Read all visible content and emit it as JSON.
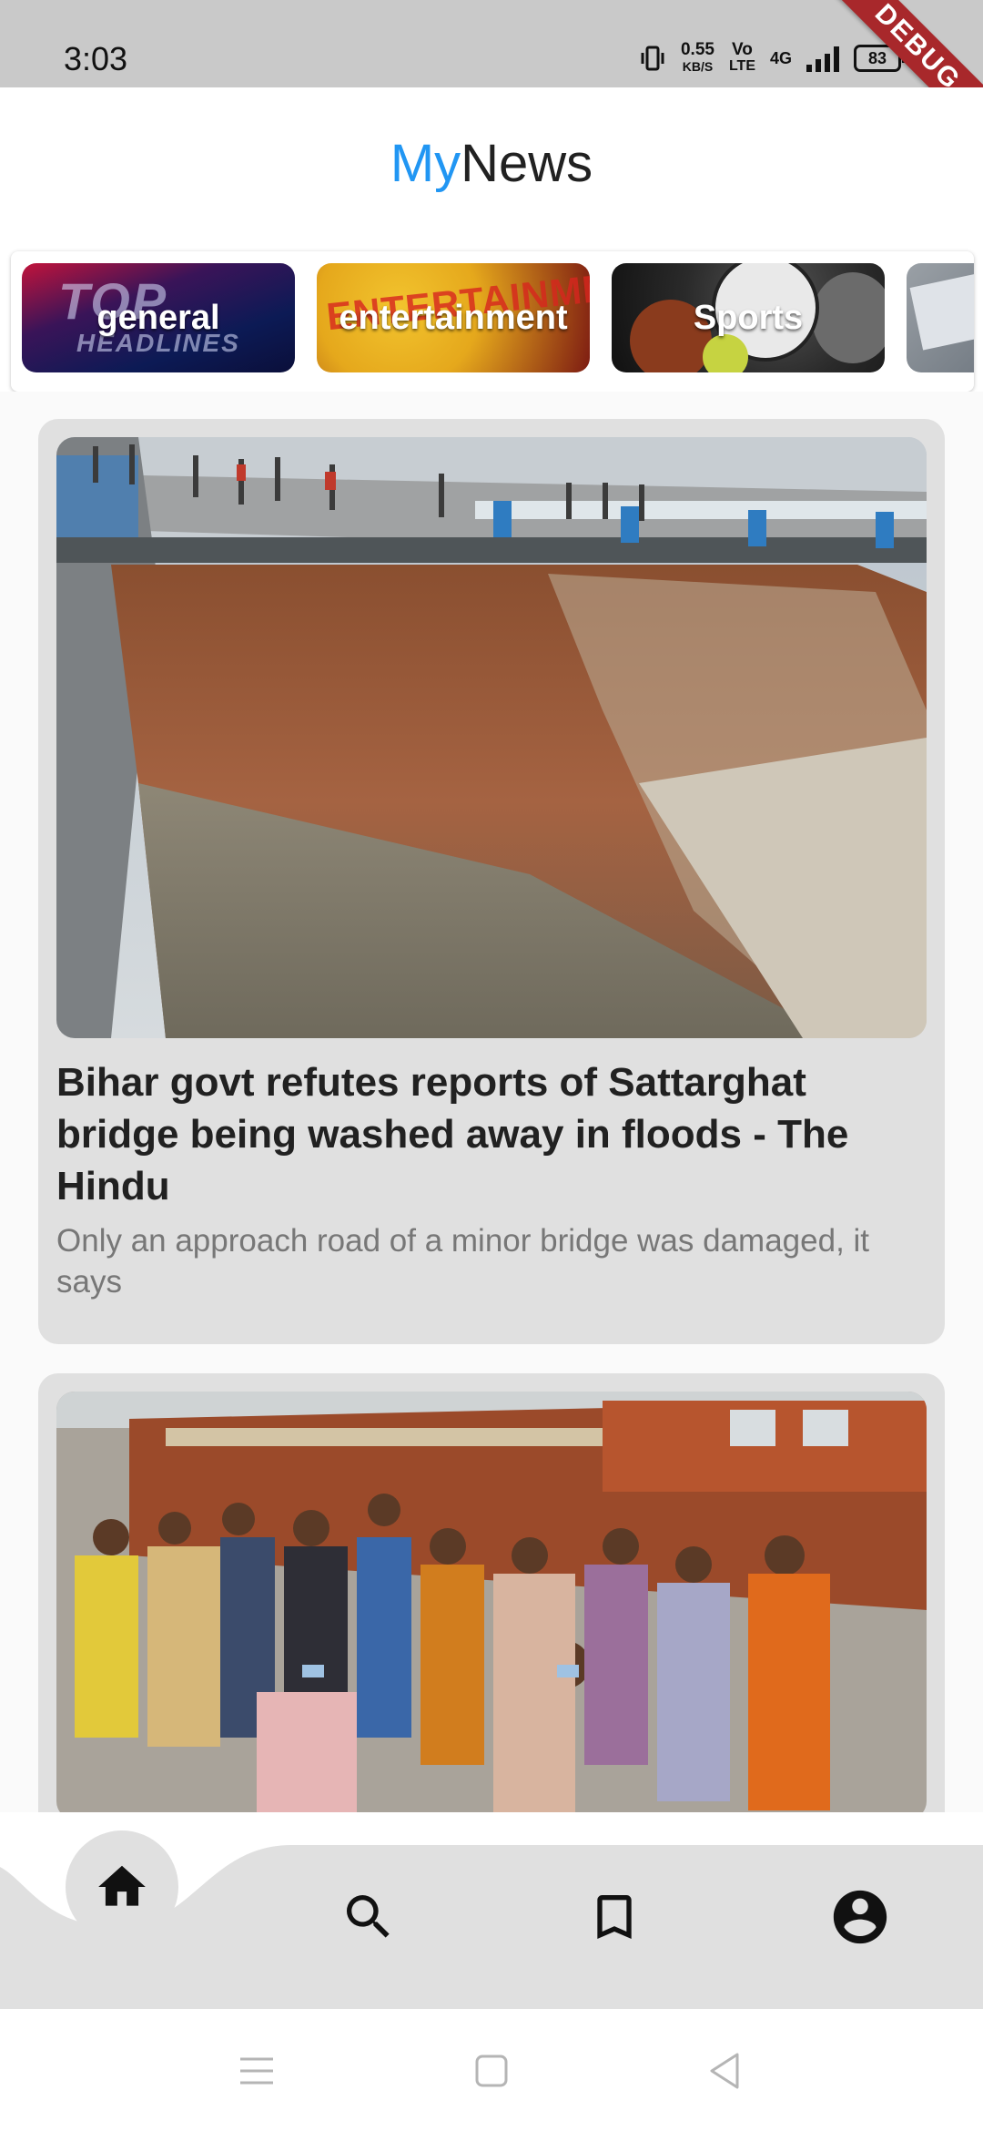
{
  "status_bar": {
    "time": "3:03",
    "speed_value": "0.55",
    "speed_unit": "KB/S",
    "volte_top": "Vo",
    "volte_bottom": "LTE",
    "network": "4G",
    "battery": "83",
    "debug_banner": "DEBUG"
  },
  "app_bar": {
    "title_part1": "My",
    "title_part2": "News",
    "accent_color": "#2196f3"
  },
  "categories": [
    {
      "label": "general",
      "image_text_top": "TOP",
      "image_text_bottom": "HEADLINES"
    },
    {
      "label": "entertainment",
      "image_text_top": "ENTERTAINMENT"
    },
    {
      "label": "Sports"
    },
    {
      "label": ""
    }
  ],
  "articles": [
    {
      "title": "Bihar govt refutes reports of Sattarghat bridge being washed away in floods - The Hindu",
      "description": "Only an approach road of a minor bridge was damaged, it says",
      "image": "collapsed-bridge-photo"
    },
    {
      "title": "",
      "description": "",
      "image": "railway-platform-crowd-photo"
    }
  ],
  "bottom_nav": {
    "items": [
      {
        "icon": "home-icon",
        "active": true
      },
      {
        "icon": "search-icon",
        "active": false
      },
      {
        "icon": "bookmark-icon",
        "active": false
      },
      {
        "icon": "account-circle-icon",
        "active": false
      }
    ]
  },
  "system_nav": [
    "menu-icon",
    "home-square-icon",
    "back-triangle-icon"
  ]
}
